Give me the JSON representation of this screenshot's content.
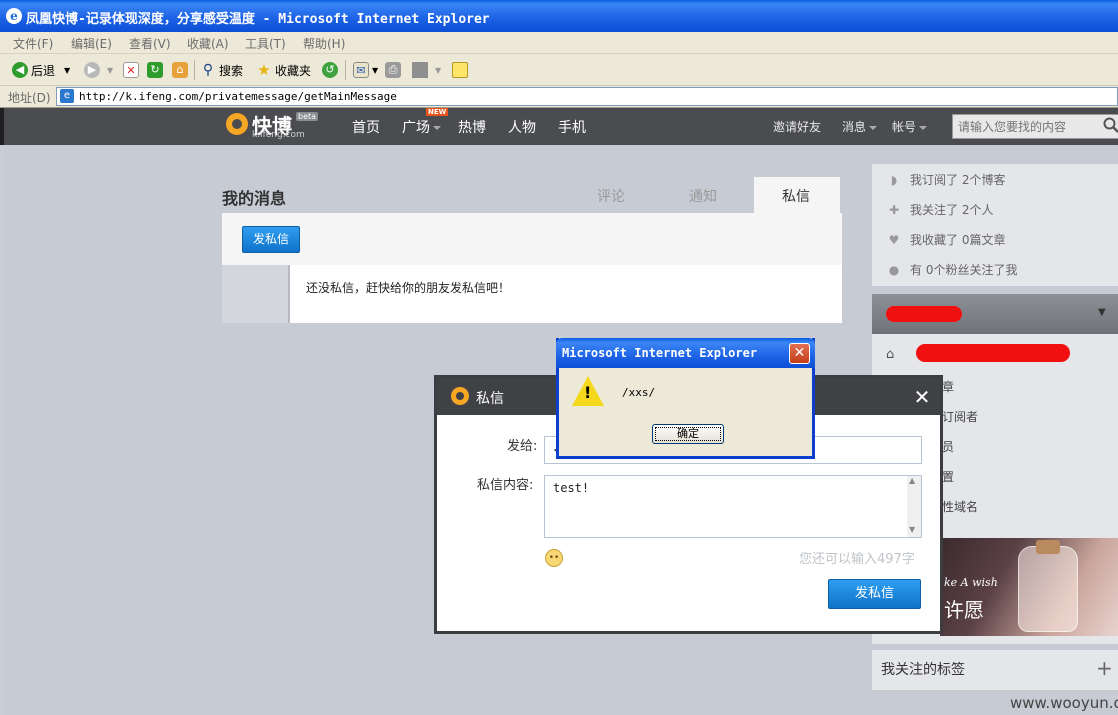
{
  "window": {
    "title": "凤凰快博-记录体现深度，分享感受温度 - Microsoft Internet Explorer"
  },
  "menu": [
    "文件(F)",
    "编辑(E)",
    "查看(V)",
    "收藏(A)",
    "工具(T)",
    "帮助(H)"
  ],
  "toolbar": {
    "back": "后退",
    "search": "搜索",
    "favorites": "收藏夹"
  },
  "address": {
    "label": "地址(D)",
    "url": "http://k.ifeng.com/privatemessage/getMainMessage"
  },
  "site": {
    "logo": "快博",
    "logo_sub": "k.ifeng.com",
    "beta": "beta",
    "nav": [
      "首页",
      "广场",
      "热博",
      "人物",
      "手机"
    ],
    "new_badge": "NEW",
    "invite": "邀请好友",
    "messages": "消息",
    "account": "帐号",
    "search_placeholder": "请输入您要找的内容"
  },
  "messages_page": {
    "title": "我的消息",
    "tabs": [
      "评论",
      "通知",
      "私信"
    ],
    "send_button": "发私信",
    "empty_text": "还没私信，赶快给你的朋友发私信吧！"
  },
  "sidebar": {
    "stats": [
      "我订阅了 2个博客",
      "我关注了 2个人",
      "我收藏了 0篇文章",
      "有 0个粉丝关注了我"
    ],
    "menu_fragments": [
      "章",
      "订阅者",
      "员",
      "置",
      "性域名"
    ],
    "banner_text": "ke A wish",
    "banner_cn": "许愿",
    "tags_label": "我关注的标签",
    "plus": "+"
  },
  "compose": {
    "title": "私信",
    "to_label": "发给:",
    "to_prefix": "<",
    "content_label": "私信内容:",
    "content_value": "test!",
    "remaining": "您还可以输入497字",
    "send_button": "发私信"
  },
  "alert": {
    "title": "Microsoft Internet Explorer",
    "message": "/xxs/",
    "ok": "确定"
  },
  "watermark": "www.wooyun.org"
}
